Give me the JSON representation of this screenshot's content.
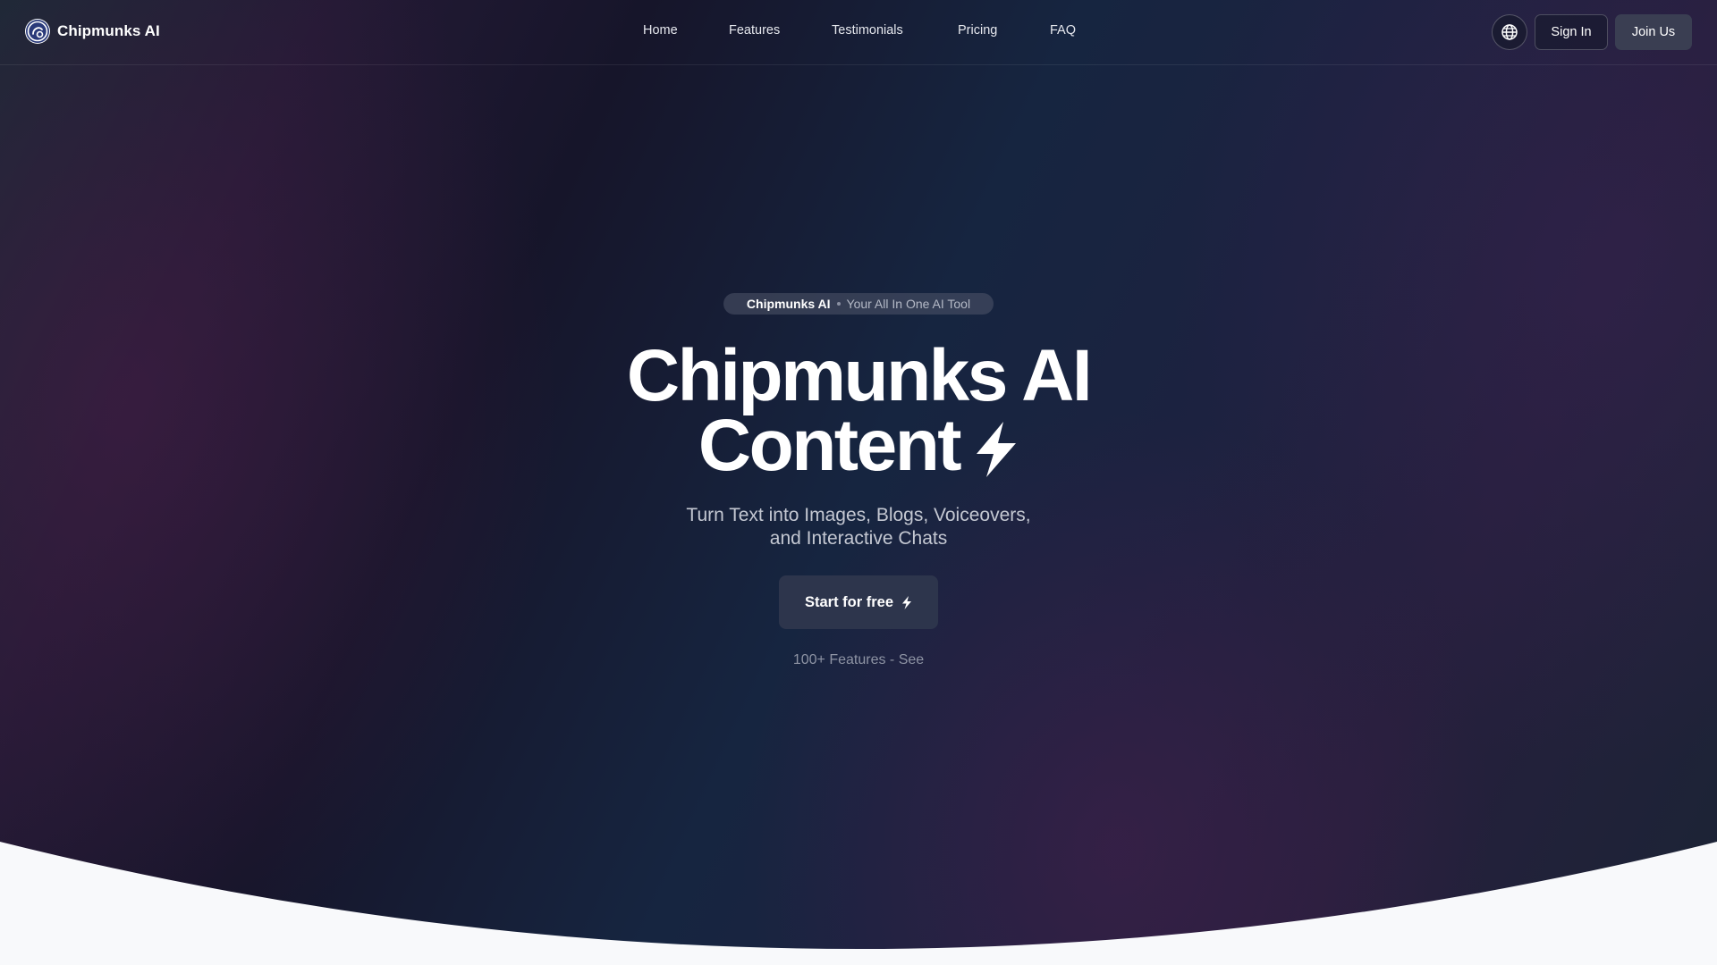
{
  "brand": {
    "name": "Chipmunks AI",
    "logo_icon": "chipmunk-logo-icon"
  },
  "nav": {
    "items": [
      {
        "label": "Home"
      },
      {
        "label": "Features"
      },
      {
        "label": "Testimonials"
      },
      {
        "label": "Pricing"
      },
      {
        "label": "FAQ"
      }
    ]
  },
  "header_actions": {
    "language_icon": "globe-icon",
    "sign_in_label": "Sign In",
    "join_label": "Join Us"
  },
  "hero": {
    "pill_brand": "Chipmunks AI",
    "pill_tagline": "Your All In One AI Tool",
    "headline_line1": "Chipmunks AI",
    "headline_line2": "Content",
    "headline_icon": "lightning-bolt-icon",
    "subtitle_line1": "Turn Text into Images, Blogs, Voiceovers,",
    "subtitle_line2": "and Interactive Chats",
    "cta_label": "Start for free",
    "cta_icon": "lightning-bolt-icon",
    "features_link": "100+ Features - See"
  },
  "colors": {
    "hero_dark": "#16152a",
    "hero_blue": "#162540",
    "hero_purple": "#261f3d",
    "cta_bg": "#2d354c",
    "join_bg": "#3a3e52",
    "page_bg": "#f8f9fb",
    "text_primary": "#ffffff",
    "text_muted": "#8e94a4"
  }
}
